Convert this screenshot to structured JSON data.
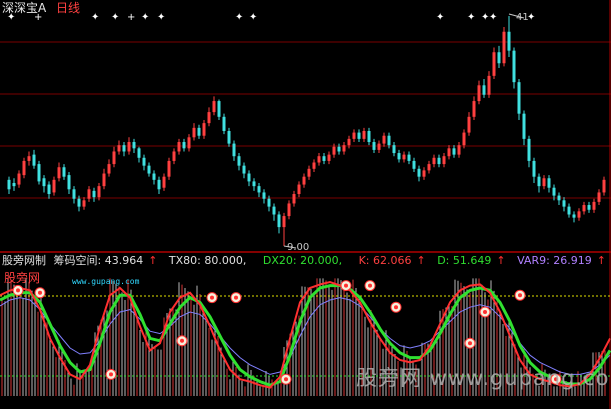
{
  "header": {
    "stock_name": "深深宝A",
    "period": "日线"
  },
  "price_panel": {
    "high_label": "41",
    "low_label": "9.00"
  },
  "indicator_bar": {
    "name": "股旁网制",
    "items": [
      {
        "label": "筹码空间: 43.964",
        "color": "#e0e0e0",
        "arrow": "↑"
      },
      {
        "label": "TX80: 80.000,",
        "color": "#e0e0e0",
        "arrow": ""
      },
      {
        "label": "DX20: 20.000,",
        "color": "#30e030",
        "arrow": ""
      },
      {
        "label": "K: 62.066",
        "color": "#ff4040",
        "arrow": "↑"
      },
      {
        "label": "D: 51.649",
        "color": "#30e030",
        "arrow": "↑"
      },
      {
        "label": "VAR9: 26.919",
        "color": "#b080ff",
        "arrow": "↑"
      }
    ]
  },
  "watermarks": {
    "brand_cn": "股旁网",
    "brand_url": "www.gupang.com",
    "bottom": "股旁网 www.gupang.com"
  },
  "colors": {
    "up": "#ff4040",
    "down": "#40e0e0",
    "k_line": "#ff3030",
    "d_line": "#30e030",
    "var9_line": "#8080ff",
    "ref_80": "#e0e000",
    "ref_20": "#30e030"
  },
  "candles": [
    [
      9,
      13.2,
      12.6,
      13.4,
      12.3
    ],
    [
      14,
      13.0,
      12.8,
      13.3,
      12.5
    ],
    [
      19,
      12.9,
      13.6,
      13.8,
      12.7
    ],
    [
      24,
      13.5,
      14.4,
      14.6,
      13.3
    ],
    [
      29,
      14.4,
      14.7,
      15.0,
      14.1
    ],
    [
      34,
      14.8,
      14.1,
      15.1,
      13.9
    ],
    [
      39,
      14.2,
      13.1,
      14.4,
      12.9
    ],
    [
      44,
      13.3,
      12.8,
      13.5,
      12.4
    ],
    [
      49,
      12.9,
      12.3,
      13.1,
      12.0
    ],
    [
      54,
      12.4,
      13.2,
      13.4,
      12.2
    ],
    [
      59,
      13.3,
      14.0,
      14.3,
      13.1
    ],
    [
      64,
      14.0,
      13.4,
      14.2,
      13.2
    ],
    [
      69,
      13.5,
      12.6,
      13.7,
      12.3
    ],
    [
      74,
      12.6,
      12.0,
      12.8,
      11.7
    ],
    [
      79,
      12.0,
      11.5,
      12.2,
      11.2
    ],
    [
      84,
      11.5,
      11.9,
      12.1,
      11.3
    ],
    [
      89,
      12.0,
      12.6,
      12.8,
      11.8
    ],
    [
      94,
      12.5,
      12.1,
      12.7,
      11.8
    ],
    [
      99,
      12.1,
      12.8,
      13.0,
      11.9
    ],
    [
      104,
      12.8,
      13.6,
      13.9,
      12.6
    ],
    [
      109,
      13.6,
      14.2,
      14.5,
      13.4
    ],
    [
      114,
      14.2,
      15.0,
      15.3,
      14.0
    ],
    [
      119,
      15.0,
      15.4,
      15.7,
      14.8
    ],
    [
      124,
      15.4,
      15.0,
      15.6,
      14.7
    ],
    [
      129,
      15.0,
      15.6,
      15.9,
      14.8
    ],
    [
      134,
      15.6,
      15.2,
      15.8,
      14.9
    ],
    [
      139,
      15.2,
      14.6,
      15.3,
      14.3
    ],
    [
      144,
      14.6,
      14.1,
      14.8,
      13.8
    ],
    [
      149,
      14.1,
      13.6,
      14.3,
      13.4
    ],
    [
      154,
      13.6,
      13.2,
      13.8,
      12.9
    ],
    [
      159,
      13.2,
      12.6,
      13.4,
      12.3
    ],
    [
      164,
      12.7,
      13.4,
      13.6,
      12.5
    ],
    [
      169,
      13.4,
      14.4,
      14.6,
      13.2
    ],
    [
      174,
      14.4,
      15.0,
      15.2,
      14.2
    ],
    [
      179,
      15.0,
      15.6,
      15.8,
      14.8
    ],
    [
      184,
      15.6,
      15.2,
      15.8,
      15.0
    ],
    [
      189,
      15.2,
      15.9,
      16.1,
      15.0
    ],
    [
      194,
      15.9,
      16.5,
      16.8,
      15.7
    ],
    [
      199,
      16.5,
      16.0,
      16.7,
      15.8
    ],
    [
      204,
      16.0,
      16.8,
      17.0,
      15.8
    ],
    [
      209,
      16.8,
      17.5,
      17.8,
      16.6
    ],
    [
      214,
      17.5,
      18.2,
      18.5,
      17.3
    ],
    [
      219,
      18.2,
      17.2,
      18.3,
      17.0
    ],
    [
      224,
      17.2,
      16.3,
      17.4,
      16.1
    ],
    [
      229,
      16.3,
      15.5,
      16.5,
      15.3
    ],
    [
      234,
      15.5,
      14.7,
      15.7,
      14.4
    ],
    [
      239,
      14.7,
      14.1,
      14.9,
      13.8
    ],
    [
      244,
      14.1,
      13.6,
      14.3,
      13.3
    ],
    [
      249,
      13.6,
      13.1,
      13.8,
      12.8
    ],
    [
      254,
      13.1,
      12.8,
      13.3,
      12.5
    ],
    [
      259,
      12.8,
      12.4,
      13.0,
      12.1
    ],
    [
      264,
      12.4,
      12.0,
      12.6,
      11.7
    ],
    [
      269,
      12.0,
      11.5,
      12.2,
      11.2
    ],
    [
      274,
      11.5,
      11.0,
      11.7,
      10.6
    ],
    [
      279,
      11.0,
      10.2,
      11.2,
      9.8
    ],
    [
      284,
      10.2,
      10.9,
      11.1,
      9.0
    ],
    [
      289,
      10.9,
      11.7,
      11.9,
      10.7
    ],
    [
      294,
      11.7,
      12.3,
      12.5,
      11.5
    ],
    [
      299,
      12.3,
      12.9,
      13.1,
      12.1
    ],
    [
      304,
      12.9,
      13.4,
      13.6,
      12.7
    ],
    [
      309,
      13.4,
      13.9,
      14.1,
      13.2
    ],
    [
      314,
      13.9,
      14.3,
      14.5,
      13.7
    ],
    [
      319,
      14.3,
      14.7,
      14.9,
      14.1
    ],
    [
      324,
      14.7,
      14.4,
      14.9,
      14.2
    ],
    [
      329,
      14.4,
      14.8,
      15.0,
      14.2
    ],
    [
      334,
      14.8,
      15.3,
      15.5,
      14.6
    ],
    [
      339,
      15.3,
      15.0,
      15.5,
      14.8
    ],
    [
      344,
      15.0,
      15.4,
      15.6,
      14.8
    ],
    [
      349,
      15.4,
      15.8,
      16.0,
      15.2
    ],
    [
      354,
      15.8,
      16.2,
      16.4,
      15.6
    ],
    [
      359,
      16.2,
      15.8,
      16.4,
      15.6
    ],
    [
      364,
      15.8,
      16.3,
      16.5,
      15.6
    ],
    [
      369,
      16.3,
      15.6,
      16.5,
      15.4
    ],
    [
      374,
      15.6,
      15.1,
      15.8,
      14.9
    ],
    [
      379,
      15.1,
      15.5,
      15.7,
      14.9
    ],
    [
      384,
      15.5,
      16.0,
      16.2,
      15.3
    ],
    [
      389,
      16.0,
      15.4,
      16.2,
      15.2
    ],
    [
      394,
      15.4,
      14.9,
      15.6,
      14.7
    ],
    [
      399,
      14.9,
      14.5,
      15.1,
      14.3
    ],
    [
      404,
      14.5,
      14.8,
      15.0,
      14.3
    ],
    [
      409,
      14.8,
      14.4,
      15.0,
      14.2
    ],
    [
      414,
      14.4,
      13.9,
      14.6,
      13.7
    ],
    [
      419,
      13.9,
      13.4,
      14.1,
      13.1
    ],
    [
      424,
      13.4,
      13.8,
      14.0,
      13.2
    ],
    [
      429,
      13.8,
      14.2,
      14.4,
      13.6
    ],
    [
      434,
      14.2,
      14.6,
      14.8,
      14.0
    ],
    [
      439,
      14.6,
      14.2,
      14.8,
      14.0
    ],
    [
      444,
      14.2,
      14.7,
      14.9,
      14.0
    ],
    [
      449,
      14.7,
      15.2,
      15.4,
      14.5
    ],
    [
      454,
      15.2,
      14.8,
      15.4,
      14.6
    ],
    [
      459,
      14.8,
      15.4,
      15.6,
      14.6
    ],
    [
      464,
      15.4,
      16.2,
      16.4,
      15.2
    ],
    [
      469,
      16.2,
      17.2,
      17.5,
      16.0
    ],
    [
      474,
      17.2,
      18.2,
      18.5,
      17.0
    ],
    [
      479,
      18.2,
      19.2,
      19.5,
      18.0
    ],
    [
      484,
      19.2,
      18.6,
      19.6,
      18.4
    ],
    [
      489,
      18.6,
      19.8,
      20.1,
      18.4
    ],
    [
      494,
      19.8,
      21.3,
      21.6,
      19.6
    ],
    [
      499,
      21.3,
      20.6,
      21.7,
      20.3
    ],
    [
      504,
      20.6,
      22.6,
      22.9,
      20.4
    ],
    [
      509,
      22.6,
      21.4,
      23.6,
      21.0
    ],
    [
      514,
      21.4,
      19.4,
      21.6,
      19.0
    ],
    [
      519,
      19.4,
      17.4,
      19.6,
      17.0
    ],
    [
      524,
      17.4,
      15.8,
      17.6,
      15.4
    ],
    [
      529,
      15.8,
      14.4,
      16.0,
      14.0
    ],
    [
      534,
      14.4,
      13.4,
      14.6,
      13.0
    ],
    [
      539,
      13.4,
      12.8,
      13.6,
      12.4
    ],
    [
      544,
      12.8,
      13.3,
      13.5,
      12.6
    ],
    [
      549,
      13.3,
      12.7,
      13.5,
      12.4
    ],
    [
      554,
      12.7,
      12.2,
      12.9,
      11.9
    ],
    [
      559,
      12.2,
      11.9,
      12.4,
      11.6
    ],
    [
      564,
      11.9,
      11.5,
      12.1,
      11.2
    ],
    [
      569,
      11.5,
      11.0,
      11.7,
      10.8
    ],
    [
      574,
      11.0,
      10.8,
      11.2,
      10.5
    ],
    [
      579,
      10.8,
      11.2,
      11.4,
      10.6
    ],
    [
      584,
      11.2,
      11.6,
      11.8,
      11.0
    ],
    [
      589,
      11.6,
      11.3,
      11.8,
      11.1
    ],
    [
      594,
      11.3,
      11.8,
      12.0,
      11.1
    ],
    [
      599,
      11.8,
      12.4,
      12.6,
      11.6
    ],
    [
      604,
      12.4,
      13.2,
      13.4,
      12.2
    ]
  ],
  "indicator": {
    "x": [
      0,
      10,
      20,
      30,
      40,
      50,
      60,
      70,
      80,
      90,
      100,
      110,
      120,
      130,
      140,
      150,
      160,
      170,
      180,
      190,
      200,
      210,
      220,
      230,
      240,
      250,
      260,
      270,
      280,
      290,
      300,
      310,
      320,
      330,
      340,
      350,
      360,
      370,
      380,
      390,
      400,
      410,
      420,
      430,
      440,
      450,
      460,
      470,
      480,
      490,
      500,
      510,
      520,
      530,
      540,
      550,
      560,
      570,
      580,
      590,
      600,
      610
    ],
    "k": [
      84,
      88,
      90,
      88,
      72,
      48,
      32,
      18,
      14,
      26,
      58,
      84,
      90,
      82,
      58,
      38,
      44,
      70,
      82,
      86,
      76,
      58,
      38,
      22,
      14,
      12,
      9,
      7,
      16,
      48,
      78,
      90,
      93,
      95,
      92,
      88,
      78,
      62,
      48,
      36,
      30,
      28,
      30,
      42,
      60,
      78,
      88,
      92,
      93,
      86,
      70,
      50,
      30,
      18,
      14,
      12,
      9,
      8,
      10,
      18,
      32,
      48
    ],
    "d": [
      80,
      84,
      86,
      86,
      78,
      60,
      42,
      28,
      20,
      22,
      44,
      70,
      84,
      84,
      68,
      48,
      46,
      60,
      74,
      82,
      78,
      66,
      50,
      34,
      22,
      16,
      12,
      9,
      12,
      34,
      62,
      82,
      90,
      92,
      92,
      89,
      82,
      70,
      56,
      44,
      36,
      32,
      32,
      38,
      52,
      68,
      82,
      88,
      90,
      88,
      78,
      62,
      42,
      28,
      20,
      16,
      12,
      10,
      10,
      14,
      24,
      38
    ],
    "var9": [
      75,
      80,
      82,
      80,
      72,
      60,
      50,
      40,
      35,
      36,
      46,
      60,
      70,
      72,
      64,
      54,
      52,
      58,
      66,
      70,
      68,
      60,
      50,
      40,
      32,
      26,
      22,
      18,
      20,
      32,
      50,
      66,
      76,
      80,
      82,
      80,
      75,
      66,
      56,
      48,
      42,
      40,
      42,
      46,
      54,
      62,
      70,
      74,
      76,
      74,
      66,
      56,
      44,
      34,
      28,
      24,
      20,
      18,
      18,
      20,
      26,
      34
    ]
  }
}
